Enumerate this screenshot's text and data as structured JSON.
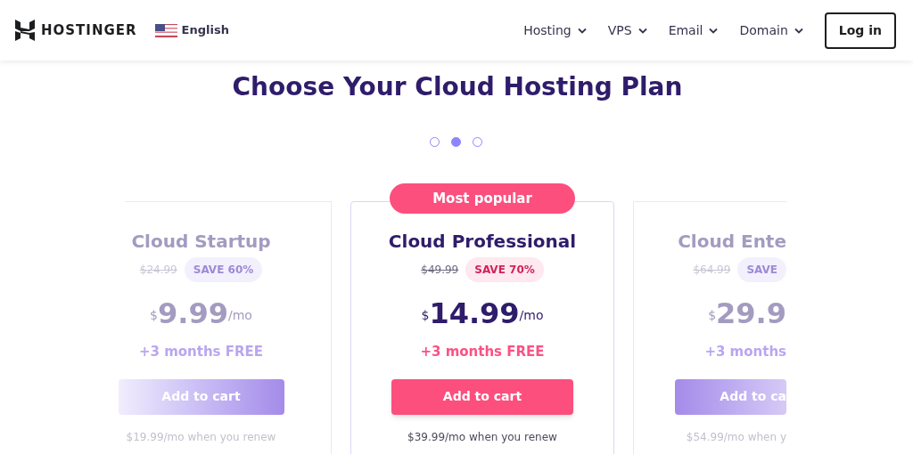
{
  "header": {
    "brand": "HOSTINGER",
    "language": "English",
    "nav": [
      {
        "label": "Hosting"
      },
      {
        "label": "VPS"
      },
      {
        "label": "Email"
      },
      {
        "label": "Domain"
      }
    ],
    "login": "Log in"
  },
  "heading": "Choose Your Cloud Hosting Plan",
  "carousel_dots": [
    {
      "selected": false
    },
    {
      "selected": true
    },
    {
      "selected": false
    }
  ],
  "plans": [
    {
      "selected": false,
      "name": "Cloud Startup",
      "old_price": "$24.99",
      "save": "SAVE 60%",
      "currency": "$",
      "price": "9.99",
      "period": "/mo",
      "bonus": "+3 months FREE",
      "button": "Add to cart",
      "renew": "$19.99/mo when you renew"
    },
    {
      "selected": true,
      "badge": "Most popular",
      "name": "Cloud Professional",
      "old_price": "$49.99",
      "save": "SAVE 70%",
      "currency": "$",
      "price": "14.99",
      "period": "/mo",
      "bonus": "+3 months FREE",
      "button": "Add to cart",
      "renew": "$39.99/mo when you renew"
    },
    {
      "selected": false,
      "name": "Cloud Ente",
      "old_price": "$64.99",
      "save": "SAVE",
      "currency": "$",
      "price": "29.9",
      "bonus": "+3 months",
      "button": "Add to ca",
      "renew": "$54.99/mo when y"
    }
  ]
}
